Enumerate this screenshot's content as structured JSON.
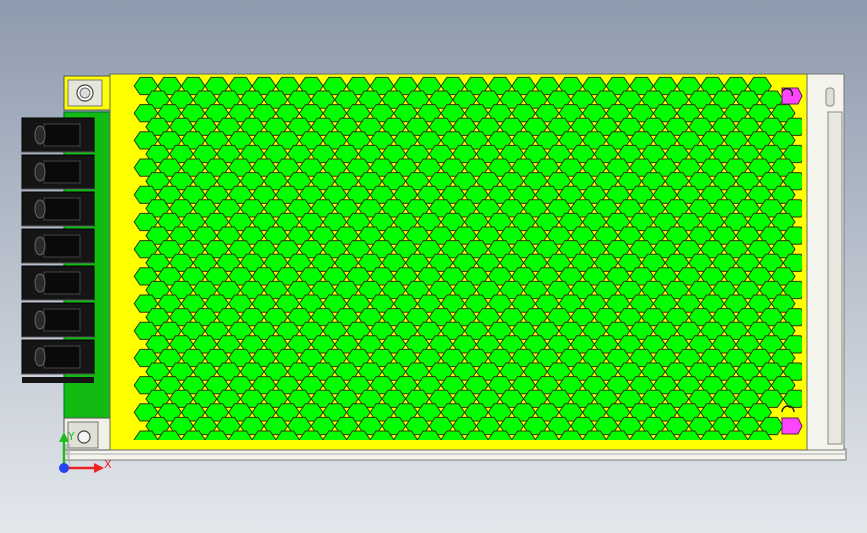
{
  "viewport": {
    "background_top": "#8e9bae",
    "background_bottom": "#e4e7ec"
  },
  "part": {
    "name": "power-supply-unit",
    "cover_color": "#ffff00",
    "vent_color": "#00ff00",
    "vent_outline": "#333300",
    "frame_color": "#f2f2ea",
    "terminal_color": "#151515",
    "terminal_count": 7,
    "clip_color": "#ff44ff",
    "pcb_color": "#11bb11"
  },
  "triad": {
    "x_label": "X",
    "y_label": "Y",
    "x_color": "#ee2222",
    "y_color": "#22bb22",
    "z_color": "#2244ee"
  }
}
